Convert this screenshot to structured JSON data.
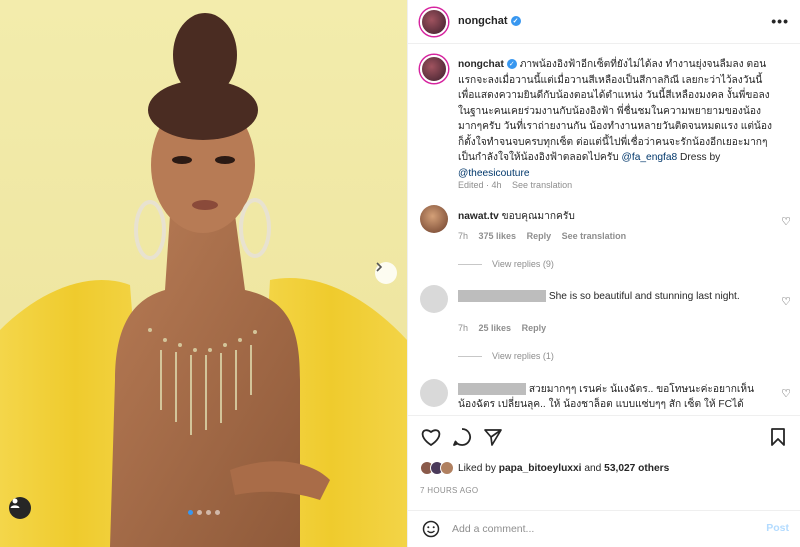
{
  "header": {
    "username": "nongchat",
    "more_label": "•••"
  },
  "caption": {
    "username": "nongchat",
    "text": "ภาพน้องอิงฟ้าอีกเซ็ตที่ยังไม่ได้ลง ทำงานยุ่งจนลืมลง ตอนแรกจะลงเมื่อวานนี้แต่เมื่อวานสีเหลืองเป็นสีกาลกิณี เลยกะว่าไว้ลงวันนี้เพื่อแสดงความยินดีกับน้องตอนได้ตำแหน่ง วันนี้สีเหลืองมงคล งั้นพี่ขอลงในฐานะคนเคยร่วมงานกับน้องอิงฟ้า พี่ชื่นชมในความพยายามของน้องมากๆครับ วันที่เราถ่ายงานกัน น้องทำงานหลายวันติดจนหมดแรง แต่น้องก็ตั้งใจทำจนจบครบทุกเซ็ต ต่อแต่นี้ไปพี่เชื่อว่าคนจะรักน้องอีกเยอะมากๆ เป็นกำลังใจให้น้องอิงฟ้าตลอดไปครับ",
    "mention1": "@fa_engfa8",
    "dress_text": "Dress by",
    "mention2": "@theesicouture",
    "edited": "Edited · 4h",
    "see_translation": "See translation"
  },
  "comments": [
    {
      "username": "nawat.tv",
      "text": "ขอบคุณมากครับ",
      "time": "7h",
      "likes": "375 likes",
      "reply": "Reply",
      "see_translation": "See translation",
      "view_replies": "View replies (9)"
    },
    {
      "username": "",
      "text": "She is so beautiful and stunning last night.",
      "time": "7h",
      "likes": "25 likes",
      "reply": "Reply",
      "view_replies": "View replies (1)"
    },
    {
      "username": "",
      "text": "สวยมากๆๆ เรนค่ะ น้แงฉัตร.. ขอโทษนะค่ะอยากเห็นน้องฉัตร เปลี่ยนลุค.. ให้ น้องชาล็อต แบบแซ่บๆๆ สัก เซ็ต ให้ FCได้"
    }
  ],
  "likes_summary": {
    "prefix": "Liked by",
    "user": "papa_bitoeyluxxi",
    "and": "and",
    "others": "53,027 others"
  },
  "time_ago": "7 HOURS AGO",
  "add_comment": {
    "placeholder": "Add a comment...",
    "post_label": "Post"
  },
  "carousel": {
    "dots": 4,
    "active_index": 0
  },
  "colors": {
    "verified": "#3897f0",
    "link": "#00376b",
    "muted": "#8e8e8e",
    "post_disabled": "#b3dbff",
    "photo_bg": "#f1e9a3",
    "dress": "#f2d23a"
  }
}
